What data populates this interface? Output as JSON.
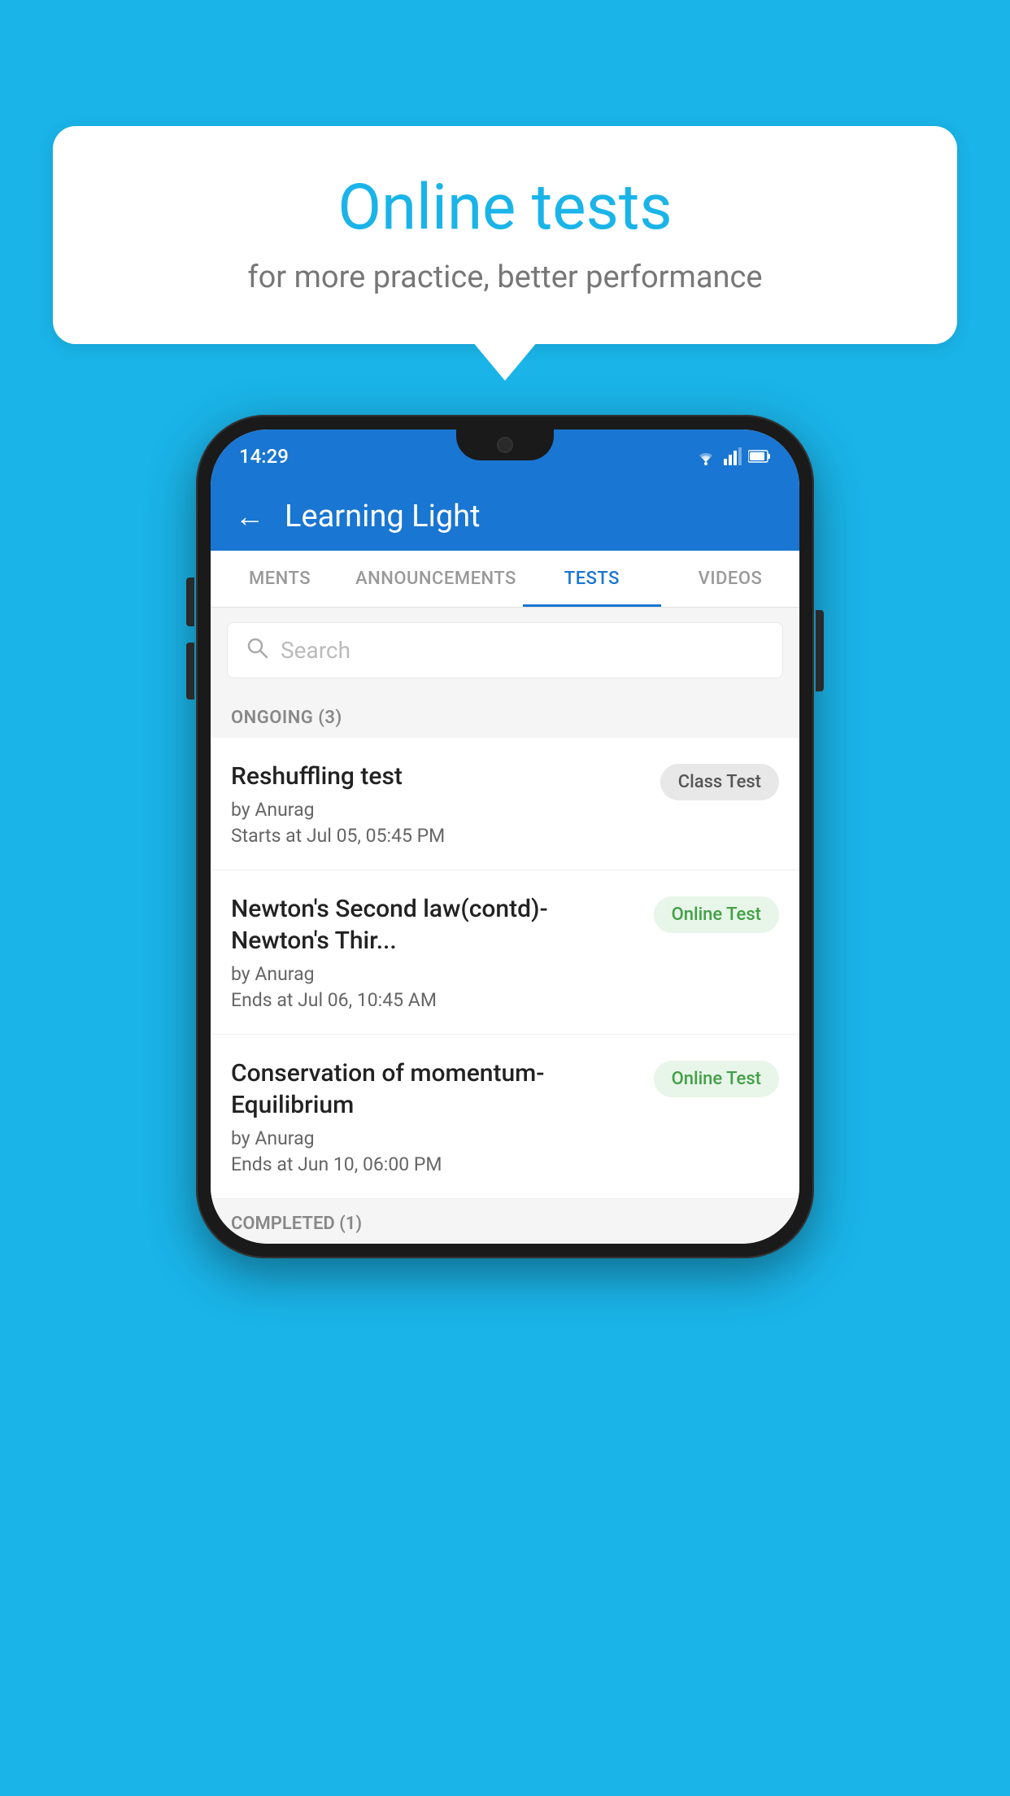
{
  "background": {
    "color": "#1ab4e8"
  },
  "speech_bubble": {
    "title": "Online tests",
    "subtitle": "for more practice, better performance"
  },
  "phone": {
    "status_bar": {
      "time": "14:29",
      "wifi": "▾",
      "signal": "▲",
      "battery": "▮"
    },
    "app_header": {
      "back_label": "←",
      "title": "Learning Light"
    },
    "tabs": [
      {
        "label": "MENTS",
        "active": false
      },
      {
        "label": "ANNOUNCEMENTS",
        "active": false
      },
      {
        "label": "TESTS",
        "active": true
      },
      {
        "label": "VIDEOS",
        "active": false
      }
    ],
    "search": {
      "placeholder": "Search"
    },
    "ongoing_section": {
      "label": "ONGOING (3)"
    },
    "test_items": [
      {
        "title": "Reshuffling test",
        "author": "by Anurag",
        "time_label": "Starts at",
        "time": "Jul 05, 05:45 PM",
        "badge": "Class Test",
        "badge_type": "class"
      },
      {
        "title": "Newton's Second law(contd)-Newton's Thir...",
        "author": "by Anurag",
        "time_label": "Ends at",
        "time": "Jul 06, 10:45 AM",
        "badge": "Online Test",
        "badge_type": "online"
      },
      {
        "title": "Conservation of momentum-Equilibrium",
        "author": "by Anurag",
        "time_label": "Ends at",
        "time": "Jun 10, 06:00 PM",
        "badge": "Online Test",
        "badge_type": "online"
      }
    ],
    "completed_section": {
      "label": "COMPLETED (1)"
    }
  }
}
